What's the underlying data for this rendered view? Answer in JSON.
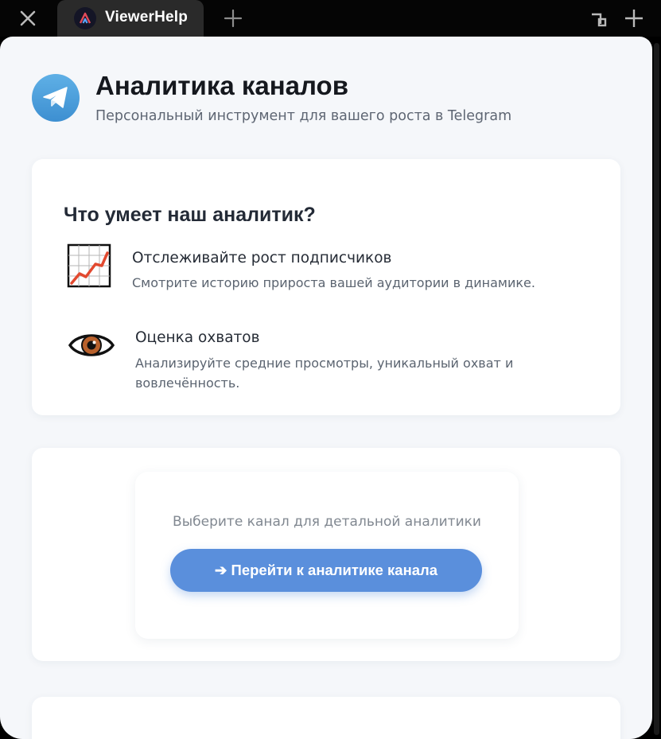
{
  "window": {
    "tab_title": "ViewerHelp",
    "icons": {
      "close": "close-icon",
      "tab_logo": "viewerhelp-logo-icon",
      "new_tab": "plus-icon",
      "shrink": "shrink-window-icon",
      "expand": "expand-window-icon"
    }
  },
  "header": {
    "logo_icon": "telegram-icon",
    "title": "Аналитика каналов",
    "subtitle": "Персональный инструмент для вашего роста в Telegram"
  },
  "features": {
    "title": "Что умеет наш аналитик?",
    "items": [
      {
        "icon": "chart-increasing-icon",
        "title": "Отслеживайте рост подписчиков",
        "description": "Смотрите историю прироста вашей аудитории в динамике."
      },
      {
        "icon": "eye-icon",
        "title": "Оценка охватов",
        "description": "Анализируйте средние просмотры, уникальный охват и вовлечённость."
      }
    ]
  },
  "action": {
    "prompt": "Выберите канал для детальной аналитики",
    "button_label": "➔ Перейти к аналитике канала"
  },
  "colors": {
    "accent": "#5a8fdc",
    "telegram_blue": "#4a9fdf",
    "page_background": "#f5f7fa",
    "card_background": "#ffffff"
  }
}
